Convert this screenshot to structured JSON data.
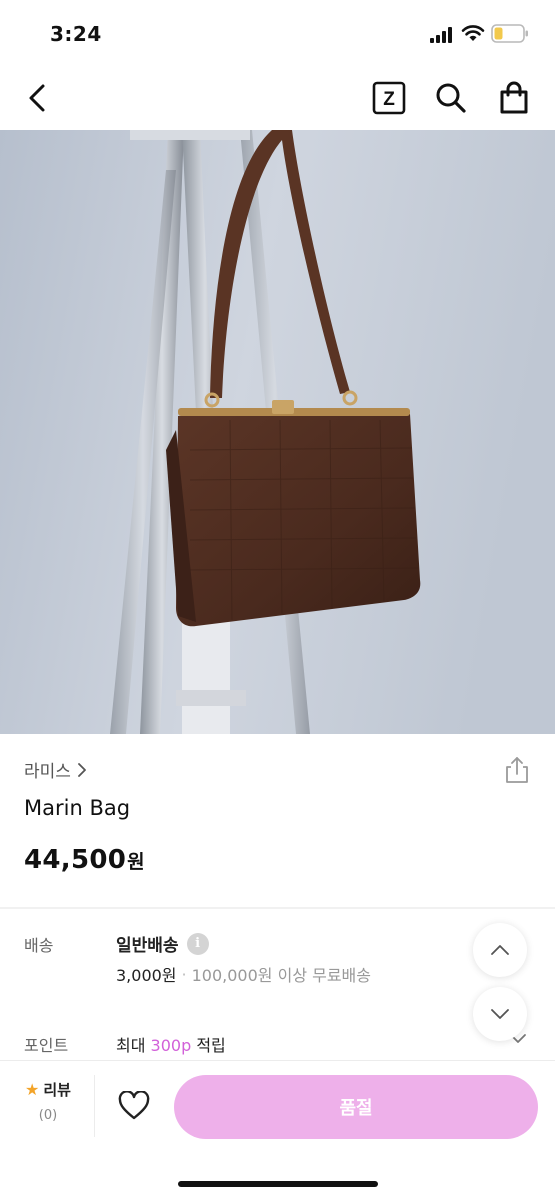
{
  "status_bar": {
    "time": "3:24"
  },
  "nav": {
    "back_icon": "chevron-left-icon",
    "z_icon": "z-box-icon",
    "z_letter": "Z",
    "search_icon": "search-icon",
    "bag_icon": "shopping-bag-icon"
  },
  "product": {
    "image": "brown-croc-handbag-photo",
    "brand": "라미스",
    "name": "Marin Bag",
    "price": "44,500",
    "price_unit": "원"
  },
  "shipping": {
    "label": "배송",
    "type": "일반배송",
    "info_glyph": "i",
    "fee": "3,000원",
    "separator": "·",
    "free_condition": "100,000원 이상 무료배송"
  },
  "points": {
    "label": "포인트",
    "prefix": "최대 ",
    "amount": "300p",
    "suffix": " 적립"
  },
  "bottom_bar": {
    "review_label": "리뷰",
    "review_count": "(0)",
    "heart_icon": "heart-outline-icon",
    "buy_label": "품절"
  },
  "colors": {
    "accent": "#d261d9",
    "sold_out_button": "#eeb0ea",
    "star": "#f3a429"
  }
}
